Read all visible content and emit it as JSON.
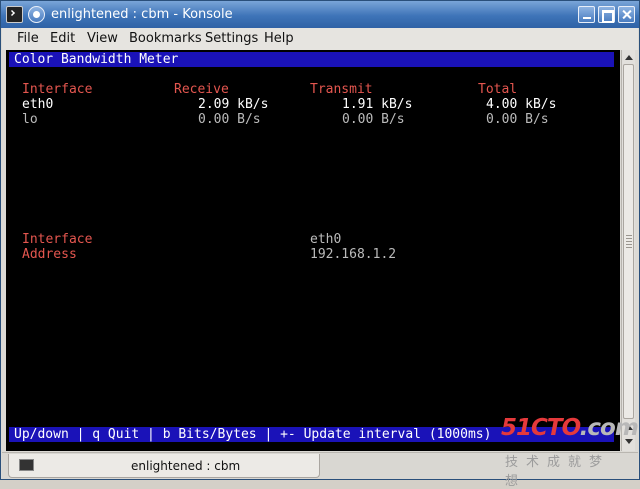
{
  "window": {
    "title": "enlightened : cbm - Konsole"
  },
  "menubar": {
    "items": [
      "File",
      "Edit",
      "View",
      "Bookmarks",
      "Settings",
      "Help"
    ]
  },
  "terminal": {
    "header_bar": "Color Bandwidth Meter",
    "table": {
      "columns": [
        "Interface",
        "Receive",
        "Transmit",
        "Total"
      ],
      "rows": [
        {
          "interface": "eth0",
          "receive": "2.09 kB/s",
          "transmit": "1.91 kB/s",
          "total": "4.00 kB/s"
        },
        {
          "interface": "lo",
          "receive": "0.00 B/s",
          "transmit": "0.00 B/s",
          "total": "0.00 B/s"
        }
      ]
    },
    "details": {
      "interface_label": "Interface",
      "interface_value": "eth0",
      "address_label": "Address",
      "address_value": "192.168.1.2"
    },
    "footer_bar": "Up/down | q Quit | b Bits/Bytes | +- Update interval (1000ms)"
  },
  "tabbar": {
    "tab_label": "enlightened : cbm"
  },
  "watermark": {
    "logo_a": "51",
    "logo_b": "CTO",
    "logo_c": ".com",
    "subtitle": "技术成就梦想"
  },
  "colors": {
    "titlebar": "#3e74b8",
    "terminal_bg": "#000000",
    "status_bar": "#1a12b8",
    "header_red": "#e4564f"
  }
}
